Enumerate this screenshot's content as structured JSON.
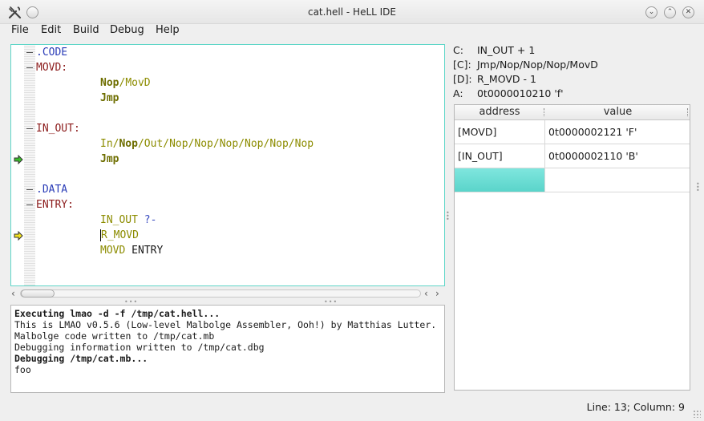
{
  "window": {
    "title": "cat.hell - HeLL IDE",
    "icons": [
      "app-wrench-icon",
      "minimize-icon",
      "maximize-icon",
      "close-icon"
    ]
  },
  "menu": {
    "items": [
      "File",
      "Edit",
      "Build",
      "Debug",
      "Help"
    ]
  },
  "editor": {
    "lines": [
      {
        "fold": true,
        "parts": [
          {
            "t": ".CODE",
            "c": "dir"
          }
        ]
      },
      {
        "fold": true,
        "parts": [
          {
            "t": "MOVD:",
            "c": "lbl"
          }
        ]
      },
      {
        "indent": true,
        "parts": [
          {
            "t": "Nop",
            "c": "opb"
          },
          {
            "t": "/",
            "c": "sep"
          },
          {
            "t": "MovD",
            "c": "op"
          }
        ]
      },
      {
        "indent": true,
        "parts": [
          {
            "t": "Jmp",
            "c": "opb"
          }
        ]
      },
      {
        "parts": []
      },
      {
        "fold": true,
        "parts": [
          {
            "t": "IN_OUT:",
            "c": "lbl"
          }
        ]
      },
      {
        "indent": true,
        "parts": [
          {
            "t": "In",
            "c": "op"
          },
          {
            "t": "/",
            "c": "sep"
          },
          {
            "t": "Nop",
            "c": "opb"
          },
          {
            "t": "/Out/Nop/Nop/Nop/Nop/Nop/Nop",
            "c": "op"
          }
        ]
      },
      {
        "indent": true,
        "marker": "green",
        "parts": [
          {
            "t": "Jmp",
            "c": "opb"
          }
        ]
      },
      {
        "parts": []
      },
      {
        "fold": true,
        "parts": [
          {
            "t": ".DATA",
            "c": "dir"
          }
        ]
      },
      {
        "fold": true,
        "parts": [
          {
            "t": "ENTRY:",
            "c": "lbl"
          }
        ]
      },
      {
        "indent": true,
        "parts": [
          {
            "t": "IN_OUT",
            "c": "op"
          },
          {
            "t": " ?-",
            "c": "blue"
          }
        ]
      },
      {
        "indent": true,
        "marker": "yellow",
        "cursor": true,
        "parts": [
          {
            "t": "R_MOVD",
            "c": "op"
          }
        ]
      },
      {
        "indent": true,
        "parts": [
          {
            "t": "MOVD",
            "c": "op"
          },
          {
            "t": " ENTRY",
            "c": "txt"
          }
        ]
      }
    ]
  },
  "output": {
    "lines": [
      {
        "text": "Executing lmao -d -f /tmp/cat.hell...",
        "bold": true
      },
      {
        "text": "This is LMAO v0.5.6 (Low-level Malbolge Assembler, Ooh!) by Matthias Lutter.",
        "bold": false
      },
      {
        "text": "Malbolge code written to /tmp/cat.mb",
        "bold": false
      },
      {
        "text": "Debugging information written to /tmp/cat.dbg",
        "bold": false
      },
      {
        "text": "Debugging /tmp/cat.mb...",
        "bold": true
      },
      {
        "text": "foo",
        "bold": false
      }
    ]
  },
  "registers": [
    {
      "name": "C:",
      "value": "IN_OUT + 1"
    },
    {
      "name": "[C]:",
      "value": "Jmp/Nop/Nop/Nop/MovD"
    },
    {
      "name": "[D]:",
      "value": "R_MOVD - 1"
    },
    {
      "name": "A:",
      "value": "0t0000010210 'f'"
    }
  ],
  "memory_table": {
    "headers": [
      "address",
      "value"
    ],
    "rows": [
      [
        "[MOVD]",
        "0t0000002121 'F'"
      ],
      [
        "[IN_OUT]",
        "0t0000002110 'B'"
      ],
      [
        "",
        ""
      ]
    ],
    "selected_row": 2
  },
  "status": {
    "position": "Line: 13; Column: 9"
  },
  "colors": {
    "accent": "#5fd6c8",
    "directive": "#2a3cb7",
    "label": "#8b1a1a",
    "opcode": "#8c8c00"
  }
}
